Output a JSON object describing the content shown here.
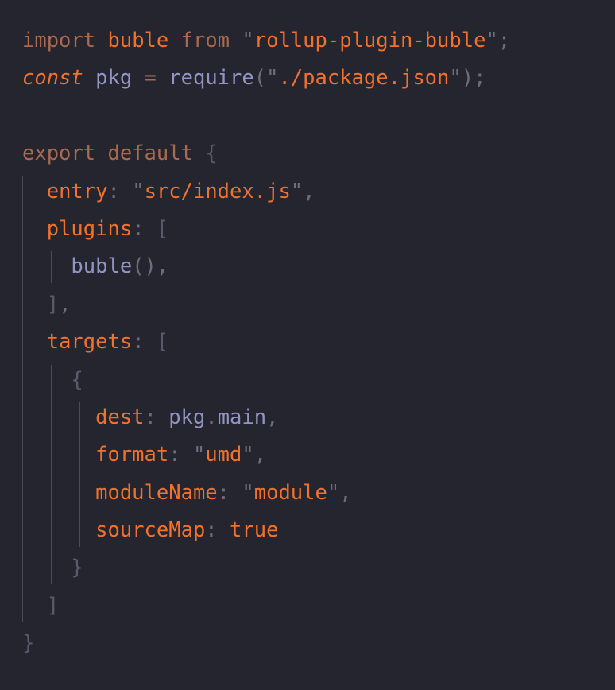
{
  "editor": {
    "language": "javascript",
    "filename_hint": "rollup.config.js",
    "theme": {
      "background": "#25252f",
      "keyword": "#a86a50",
      "const_keyword": "#f2712c",
      "identifier": "#f2712c",
      "variable": "#9294c4",
      "string": "#f2712c",
      "quote": "#6c6e80",
      "punctuation": "#6c6e80",
      "brace": "#595b6d",
      "boolean": "#f2712c",
      "indent_guide": "#4a4c5c"
    },
    "font_size_px": 25.5,
    "line_height_px": 47.4,
    "indent_guides_x": [
      28,
      64,
      100
    ]
  },
  "code": {
    "lines": [
      {
        "n": 1,
        "indent": 0,
        "tokens": [
          {
            "t": "import",
            "c": "kw"
          },
          {
            "t": " ",
            "c": "plain"
          },
          {
            "t": "buble",
            "c": "ident"
          },
          {
            "t": " ",
            "c": "plain"
          },
          {
            "t": "from",
            "c": "kw"
          },
          {
            "t": " ",
            "c": "plain"
          },
          {
            "t": "\"",
            "c": "quote"
          },
          {
            "t": "rollup-plugin-buble",
            "c": "str"
          },
          {
            "t": "\"",
            "c": "quote"
          },
          {
            "t": ";",
            "c": "punc"
          }
        ]
      },
      {
        "n": 2,
        "indent": 0,
        "tokens": [
          {
            "t": "const",
            "c": "kw-it"
          },
          {
            "t": " ",
            "c": "plain"
          },
          {
            "t": "pkg",
            "c": "var"
          },
          {
            "t": " ",
            "c": "plain"
          },
          {
            "t": "=",
            "c": "kw"
          },
          {
            "t": " ",
            "c": "plain"
          },
          {
            "t": "require",
            "c": "var"
          },
          {
            "t": "(",
            "c": "punc"
          },
          {
            "t": "\"",
            "c": "quote"
          },
          {
            "t": "./package.json",
            "c": "str"
          },
          {
            "t": "\"",
            "c": "quote"
          },
          {
            "t": ")",
            "c": "punc"
          },
          {
            "t": ";",
            "c": "punc"
          }
        ]
      },
      {
        "n": 3,
        "indent": 0,
        "blank": true,
        "tokens": []
      },
      {
        "n": 4,
        "indent": 0,
        "tokens": [
          {
            "t": "export",
            "c": "kw"
          },
          {
            "t": " ",
            "c": "plain"
          },
          {
            "t": "default",
            "c": "kw"
          },
          {
            "t": " ",
            "c": "plain"
          },
          {
            "t": "{",
            "c": "brace"
          }
        ]
      },
      {
        "n": 5,
        "indent": 1,
        "tokens": [
          {
            "t": "entry",
            "c": "ident"
          },
          {
            "t": ":",
            "c": "punc"
          },
          {
            "t": " ",
            "c": "plain"
          },
          {
            "t": "\"",
            "c": "quote"
          },
          {
            "t": "src/index.js",
            "c": "str"
          },
          {
            "t": "\"",
            "c": "quote"
          },
          {
            "t": ",",
            "c": "punc"
          }
        ]
      },
      {
        "n": 6,
        "indent": 1,
        "tokens": [
          {
            "t": "plugins",
            "c": "ident"
          },
          {
            "t": ":",
            "c": "punc"
          },
          {
            "t": " ",
            "c": "plain"
          },
          {
            "t": "[",
            "c": "brace"
          }
        ]
      },
      {
        "n": 7,
        "indent": 2,
        "tokens": [
          {
            "t": "buble",
            "c": "var"
          },
          {
            "t": "(",
            "c": "punc"
          },
          {
            "t": ")",
            "c": "punc"
          },
          {
            "t": ",",
            "c": "punc"
          }
        ]
      },
      {
        "n": 8,
        "indent": 1,
        "tokens": [
          {
            "t": "]",
            "c": "brace"
          },
          {
            "t": ",",
            "c": "punc"
          }
        ]
      },
      {
        "n": 9,
        "indent": 1,
        "tokens": [
          {
            "t": "targets",
            "c": "ident"
          },
          {
            "t": ":",
            "c": "punc"
          },
          {
            "t": " ",
            "c": "plain"
          },
          {
            "t": "[",
            "c": "brace"
          }
        ]
      },
      {
        "n": 10,
        "indent": 2,
        "tokens": [
          {
            "t": "{",
            "c": "brace"
          }
        ]
      },
      {
        "n": 11,
        "indent": 3,
        "tokens": [
          {
            "t": "dest",
            "c": "ident"
          },
          {
            "t": ":",
            "c": "punc"
          },
          {
            "t": " ",
            "c": "plain"
          },
          {
            "t": "pkg",
            "c": "var"
          },
          {
            "t": ".",
            "c": "punc"
          },
          {
            "t": "main",
            "c": "var"
          },
          {
            "t": ",",
            "c": "punc"
          }
        ]
      },
      {
        "n": 12,
        "indent": 3,
        "tokens": [
          {
            "t": "format",
            "c": "ident"
          },
          {
            "t": ":",
            "c": "punc"
          },
          {
            "t": " ",
            "c": "plain"
          },
          {
            "t": "\"",
            "c": "quote"
          },
          {
            "t": "umd",
            "c": "str"
          },
          {
            "t": "\"",
            "c": "quote"
          },
          {
            "t": ",",
            "c": "punc"
          }
        ]
      },
      {
        "n": 13,
        "indent": 3,
        "tokens": [
          {
            "t": "moduleName",
            "c": "ident"
          },
          {
            "t": ":",
            "c": "punc"
          },
          {
            "t": " ",
            "c": "plain"
          },
          {
            "t": "\"",
            "c": "quote"
          },
          {
            "t": "module",
            "c": "str"
          },
          {
            "t": "\"",
            "c": "quote"
          },
          {
            "t": ",",
            "c": "punc"
          }
        ]
      },
      {
        "n": 14,
        "indent": 3,
        "tokens": [
          {
            "t": "sourceMap",
            "c": "ident"
          },
          {
            "t": ":",
            "c": "punc"
          },
          {
            "t": " ",
            "c": "plain"
          },
          {
            "t": "true",
            "c": "bool"
          }
        ]
      },
      {
        "n": 15,
        "indent": 2,
        "tokens": [
          {
            "t": "}",
            "c": "brace"
          }
        ]
      },
      {
        "n": 16,
        "indent": 1,
        "tokens": [
          {
            "t": "]",
            "c": "brace"
          }
        ]
      },
      {
        "n": 17,
        "indent": 0,
        "tokens": [
          {
            "t": "}",
            "c": "brace"
          }
        ]
      }
    ]
  }
}
